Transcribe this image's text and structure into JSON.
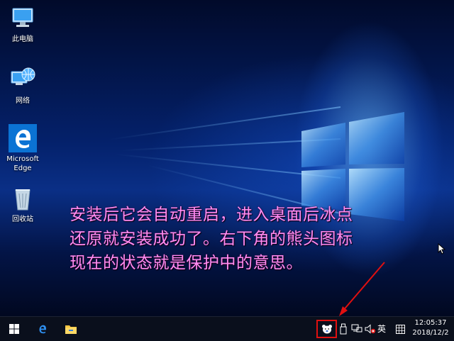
{
  "desktop": {
    "icons": [
      {
        "label": "此电脑",
        "icon": "computer-icon"
      },
      {
        "label": "网络",
        "icon": "network-globe-icon"
      },
      {
        "label": "Microsoft\nEdge",
        "icon": "edge-icon"
      },
      {
        "label": "回收站",
        "icon": "recycle-bin-icon"
      }
    ],
    "overlay_text": "安装后它会自动重启，进入桌面后冰点\n还原就安装成功了。右下角的熊头图标\n现在的状态就是保护中的意思。"
  },
  "taskbar": {
    "pinned": [
      "windows-start-icon",
      "edge-icon",
      "file-explorer-icon"
    ],
    "tray": {
      "icons": [
        "bear-head-icon",
        "usb-drive-icon",
        "network-disconnected-icon",
        "volume-muted-icon"
      ],
      "ime_label": "英",
      "keyboard_icon": "keyboard-icon",
      "time": "12:05:37",
      "date": "2018/12/2"
    }
  },
  "colors": {
    "overlay_text": "#ff8cf2",
    "highlight": "#e01010",
    "taskbar": "#0a0f1c",
    "edge_blue": "#0b73d4"
  }
}
